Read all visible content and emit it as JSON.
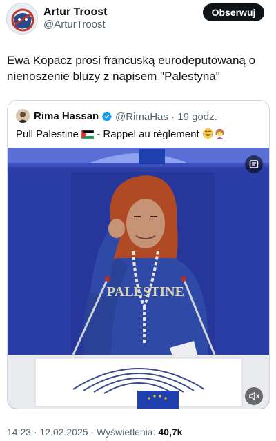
{
  "author": {
    "name": "Artur Troost",
    "handle": "@ArturTroost",
    "follow_label": "Obserwuj"
  },
  "tweet": {
    "text": "Ewa Kopacz prosi francuską eurodeputowaną o nienoszenie bluzy z napisem \"Palestyna\""
  },
  "quoted": {
    "name": "Rima Hassan",
    "handle": "@RimaHas",
    "separator": "·",
    "time": "19 godz.",
    "text_before_flag": "Pull Palestine ",
    "text_after_flag": " - Rappel au règlement ",
    "icons": [
      "verified-badge-icon",
      "palestine-flag-icon",
      "laughing-emoji-icon",
      "woman-emoji-icon",
      "gif-icon",
      "mute-icon"
    ],
    "media": {
      "sweater_text": "PALESTINE"
    }
  },
  "footer": {
    "time": "14:23",
    "sep1": "·",
    "date": "12.02.2025",
    "sep2": "·",
    "views_label": "Wyświetlenia:",
    "views_count": "40,7k"
  },
  "colors": {
    "accent": "#1d9bf0",
    "text": "#0f1419",
    "muted": "#536471",
    "video_bg": "#2a3aa0"
  }
}
